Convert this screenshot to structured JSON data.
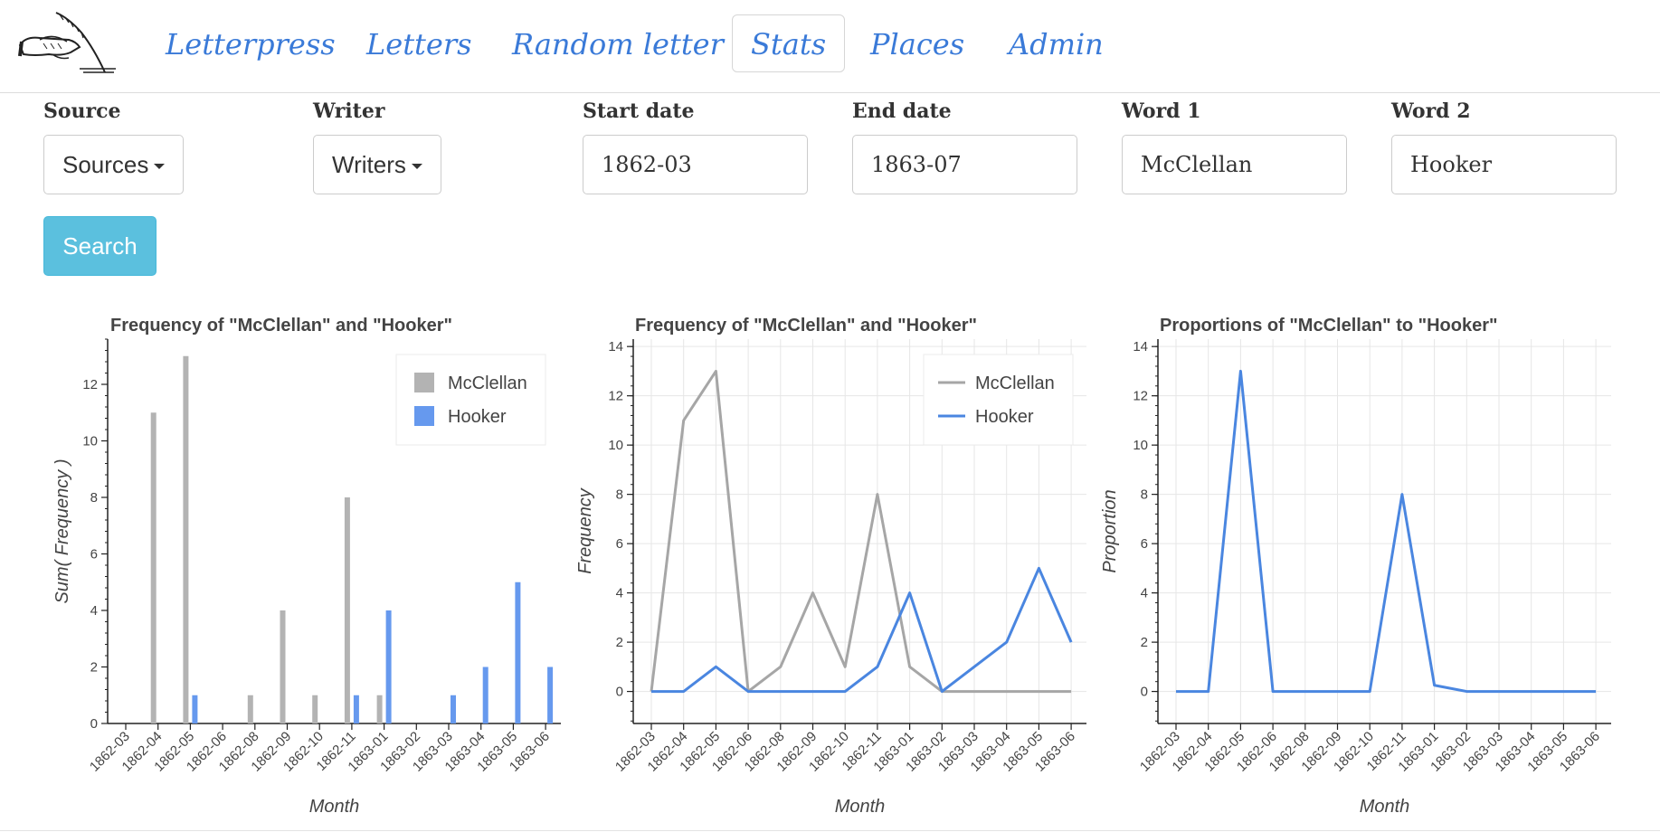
{
  "nav": {
    "items": [
      {
        "label": "Letterpress",
        "active": false
      },
      {
        "label": "Letters",
        "active": false
      },
      {
        "label": "Random letter",
        "active": false
      },
      {
        "label": "Stats",
        "active": true
      },
      {
        "label": "Places",
        "active": false
      },
      {
        "label": "Admin",
        "active": false
      }
    ],
    "logo_icon": "hand-writing-quill-icon"
  },
  "form": {
    "source": {
      "label": "Source",
      "value": "Sources"
    },
    "writer": {
      "label": "Writer",
      "value": "Writers"
    },
    "start_date": {
      "label": "Start date",
      "value": "1862-03"
    },
    "end_date": {
      "label": "End date",
      "value": "1863-07"
    },
    "word1": {
      "label": "Word 1",
      "value": "McClellan"
    },
    "word2": {
      "label": "Word 2",
      "value": "Hooker"
    },
    "search_label": "Search"
  },
  "colors": {
    "mcclellan": "#b3b3b3",
    "hooker": "#6699ee",
    "line_grey": "#a6a6a6",
    "line_blue": "#4a86e0"
  },
  "chart_data": [
    {
      "type": "bar",
      "title": "Frequency of \"McClellan\" and \"Hooker\"",
      "xlabel": "Month",
      "ylabel": "Sum( Frequency )",
      "categories": [
        "1862-03",
        "1862-04",
        "1862-05",
        "1862-06",
        "1862-08",
        "1862-09",
        "1862-10",
        "1862-11",
        "1863-01",
        "1863-02",
        "1863-03",
        "1863-04",
        "1863-05",
        "1863-06"
      ],
      "series": [
        {
          "name": "McClellan",
          "values": [
            0,
            11,
            13,
            0,
            1,
            4,
            1,
            8,
            1,
            0,
            0,
            0,
            0,
            0
          ]
        },
        {
          "name": "Hooker",
          "values": [
            0,
            0,
            1,
            0,
            0,
            0,
            0,
            1,
            4,
            0,
            1,
            2,
            5,
            2
          ]
        }
      ],
      "ylim": [
        0,
        13.6
      ],
      "yticks": [
        0,
        2,
        4,
        6,
        8,
        10,
        12
      ],
      "grid": false,
      "legend": "top-right"
    },
    {
      "type": "line",
      "title": "Frequency of \"McClellan\" and \"Hooker\"",
      "xlabel": "Month",
      "ylabel": "Frequency",
      "categories": [
        "1862-03",
        "1862-04",
        "1862-05",
        "1862-06",
        "1862-08",
        "1862-09",
        "1862-10",
        "1862-11",
        "1863-01",
        "1863-02",
        "1863-03",
        "1863-04",
        "1863-05",
        "1863-06"
      ],
      "series": [
        {
          "name": "McClellan",
          "values": [
            0,
            11,
            13,
            0,
            1,
            4,
            1,
            8,
            1,
            0,
            0,
            0,
            0,
            0
          ]
        },
        {
          "name": "Hooker",
          "values": [
            0,
            0,
            1,
            0,
            0,
            0,
            0,
            1,
            4,
            0,
            1,
            2,
            5,
            2
          ]
        }
      ],
      "ylim": [
        -1.3,
        14.3
      ],
      "yticks": [
        0,
        2,
        4,
        6,
        8,
        10,
        12,
        14
      ],
      "grid": true,
      "legend": "top-right"
    },
    {
      "type": "line",
      "title": "Proportions of \"McClellan\" to \"Hooker\"",
      "xlabel": "Month",
      "ylabel": "Proportion",
      "categories": [
        "1862-03",
        "1862-04",
        "1862-05",
        "1862-06",
        "1862-08",
        "1862-09",
        "1862-10",
        "1862-11",
        "1863-01",
        "1863-02",
        "1863-03",
        "1863-04",
        "1863-05",
        "1863-06"
      ],
      "series": [
        {
          "values": [
            0,
            0,
            13,
            0,
            0,
            0,
            0,
            8,
            0.25,
            0,
            0,
            0,
            0,
            0
          ]
        }
      ],
      "ylim": [
        -1.3,
        14.3
      ],
      "yticks": [
        0,
        2,
        4,
        6,
        8,
        10,
        12,
        14
      ],
      "grid": true
    }
  ]
}
